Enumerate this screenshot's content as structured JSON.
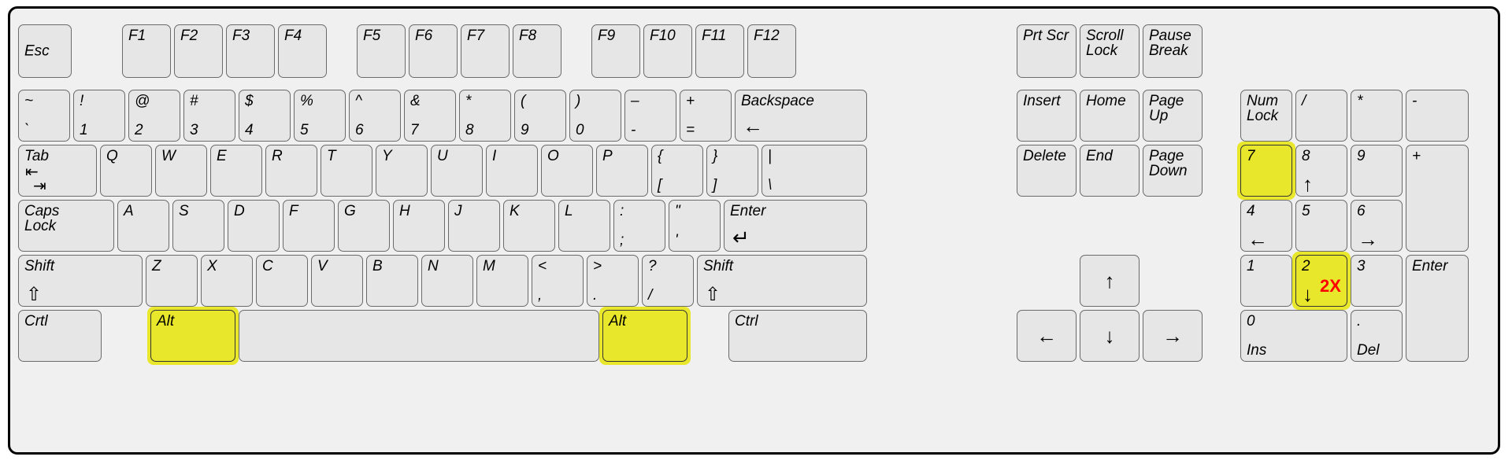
{
  "figure": {
    "type": "keyboard-layout-diagram",
    "highlight_color": "#e9e72b",
    "annotation_color": "#ff0000",
    "key_face_color": "#e6e6e6",
    "body_color": "#f0f0f0",
    "highlighted_keys": [
      "Alt (left)",
      "Alt (right)",
      "Numpad 7",
      "Numpad 2"
    ],
    "annotations": [
      {
        "key": "Numpad 2",
        "text": "2X"
      }
    ]
  },
  "function_row": {
    "esc": "Esc",
    "f_keys_group1": [
      "F1",
      "F2",
      "F3",
      "F4"
    ],
    "f_keys_group2": [
      "F5",
      "F6",
      "F7",
      "F8"
    ],
    "f_keys_group3": [
      "F9",
      "F10",
      "F11",
      "F12"
    ]
  },
  "number_row": {
    "keys": [
      {
        "top": "~",
        "bottom": "`"
      },
      {
        "top": "!",
        "bottom": "1"
      },
      {
        "top": "@",
        "bottom": "2"
      },
      {
        "top": "#",
        "bottom": "3"
      },
      {
        "top": "$",
        "bottom": "4"
      },
      {
        "top": "%",
        "bottom": "5"
      },
      {
        "top": "^",
        "bottom": "6"
      },
      {
        "top": "&",
        "bottom": "7"
      },
      {
        "top": "*",
        "bottom": "8"
      },
      {
        "top": "(",
        "bottom": "9"
      },
      {
        "top": ")",
        "bottom": "0"
      },
      {
        "top": "–",
        "bottom": "-"
      },
      {
        "top": "+",
        "bottom": "="
      }
    ],
    "backspace": {
      "label": "Backspace",
      "glyph": "←"
    }
  },
  "tab_row": {
    "tab": {
      "label": "Tab",
      "glyph_top": "⇤",
      "glyph_bottom": "⇥"
    },
    "letters": [
      "Q",
      "W",
      "E",
      "R",
      "T",
      "Y",
      "U",
      "I",
      "O",
      "P"
    ],
    "brackets": [
      {
        "top": "{",
        "bottom": "["
      },
      {
        "top": "}",
        "bottom": "]"
      },
      {
        "top": "|",
        "bottom": "\\"
      }
    ]
  },
  "home_row": {
    "caps": "Caps\nLock",
    "letters": [
      "A",
      "S",
      "D",
      "F",
      "G",
      "H",
      "J",
      "K",
      "L"
    ],
    "punct": [
      {
        "top": ":",
        "bottom": ";"
      },
      {
        "top": "\"",
        "bottom": "'"
      }
    ],
    "enter": {
      "label": "Enter",
      "glyph": "↵"
    }
  },
  "shift_row": {
    "shift_left": {
      "label": "Shift",
      "glyph": "⇧"
    },
    "letters": [
      "Z",
      "X",
      "C",
      "V",
      "B",
      "N",
      "M"
    ],
    "punct": [
      {
        "top": "<",
        "bottom": ","
      },
      {
        "top": ">",
        "bottom": "."
      },
      {
        "top": "?",
        "bottom": "/"
      }
    ],
    "shift_right": {
      "label": "Shift",
      "glyph": "⇧"
    }
  },
  "bottom_row": {
    "ctrl_left": "Crtl",
    "alt_left": "Alt",
    "space": "",
    "alt_right": "Alt",
    "ctrl_right": "Ctrl"
  },
  "nav_cluster": {
    "row1": [
      "Prt Scr",
      "Scroll\nLock",
      "Pause\nBreak"
    ],
    "row2": [
      "Insert",
      "Home",
      "Page\nUp"
    ],
    "row3": [
      "Delete",
      "End",
      "Page\nDown"
    ]
  },
  "arrow_cluster": {
    "up": "↑",
    "left": "←",
    "down": "↓",
    "right": "→"
  },
  "numpad": {
    "row1": [
      {
        "label": "Num\nLock"
      },
      {
        "label": "/"
      },
      {
        "label": "*"
      },
      {
        "label": "-"
      }
    ],
    "row2": [
      {
        "label": "7",
        "arrow": "",
        "lit": true
      },
      {
        "label": "8",
        "arrow": "↑",
        "lit": false
      },
      {
        "label": "9",
        "arrow": "",
        "lit": false
      },
      {
        "label": "+",
        "arrow": "",
        "lit": false
      }
    ],
    "row3": [
      {
        "label": "4",
        "arrow": "←",
        "lit": false
      },
      {
        "label": "5",
        "arrow": "",
        "lit": false
      },
      {
        "label": "6",
        "arrow": "→",
        "lit": false
      }
    ],
    "row4": [
      {
        "label": "1",
        "arrow": "",
        "lit": false
      },
      {
        "label": "2",
        "arrow": "↓",
        "lit": true,
        "tag": "2X"
      },
      {
        "label": "3",
        "arrow": "",
        "lit": false
      },
      {
        "label": "Enter",
        "arrow": "",
        "lit": false
      }
    ],
    "row5": [
      {
        "top": "0",
        "bottom": "Ins"
      },
      {
        "top": ".",
        "bottom": "Del"
      }
    ]
  }
}
